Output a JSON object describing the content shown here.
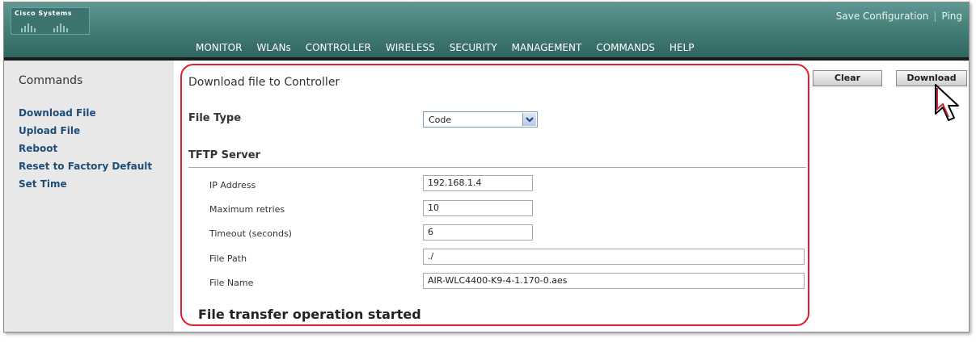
{
  "header": {
    "logo_text": "Cisco Systems",
    "save_configuration": "Save Configuration",
    "separator": "|",
    "ping": "Ping",
    "menu": [
      "MONITOR",
      "WLANs",
      "CONTROLLER",
      "WIRELESS",
      "SECURITY",
      "MANAGEMENT",
      "COMMANDS",
      "HELP"
    ],
    "active_menu": "COMMANDS"
  },
  "sidebar": {
    "title": "Commands",
    "items": [
      "Download File",
      "Upload File",
      "Reboot",
      "Reset to Factory Default",
      "Set Time"
    ]
  },
  "toolbar": {
    "clear_label": "Clear",
    "download_label": "Download"
  },
  "main": {
    "title": "Download file to Controller",
    "file_type_label": "File Type",
    "file_type_value": "Code",
    "tftp_section": "TFTP Server",
    "ip_label": "IP Address",
    "ip_value": "192.168.1.4",
    "retries_label": "Maximum retries",
    "retries_value": "10",
    "timeout_label": "Timeout (seconds)",
    "timeout_value": "6",
    "path_label": "File Path",
    "path_value": "./",
    "name_label": "File Name",
    "name_value": "AIR-WLC4400-K9-4-1.170-0.aes",
    "status": "File transfer operation started"
  },
  "colors": {
    "header": "#3f7771",
    "active_tab_underline": "#f0a030",
    "sidebar_bg": "#e8e8e8",
    "link": "#1e4d7a",
    "annotation": "#e02030"
  }
}
